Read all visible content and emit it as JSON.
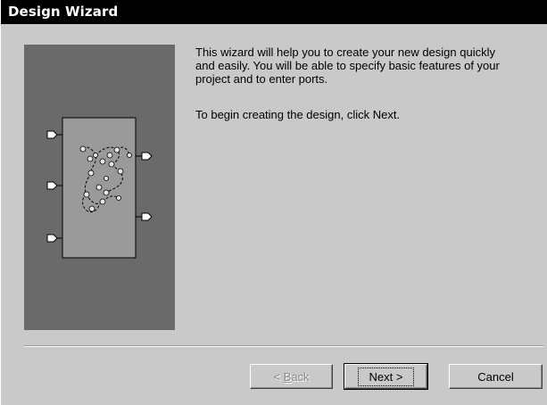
{
  "window": {
    "title": "Design Wizard"
  },
  "content": {
    "intro_text": "This wizard will help you to create your new design quickly and easily. You will be able to specify basic features of your project and to enter ports.",
    "instruction_text": "To begin creating the design, click Next."
  },
  "illustration": {
    "name": "design-block-diagram",
    "input_ports": 3,
    "output_ports": 2
  },
  "buttons": {
    "back_prefix": "< ",
    "back_mnemonic": "B",
    "back_rest": "ack",
    "next_label": "Next >",
    "cancel_label": "Cancel"
  },
  "colors": {
    "titlebar": "#000000",
    "panel": "#6a6a6a",
    "block": "#9a9a9a",
    "dialog": "#c9c9c9"
  }
}
